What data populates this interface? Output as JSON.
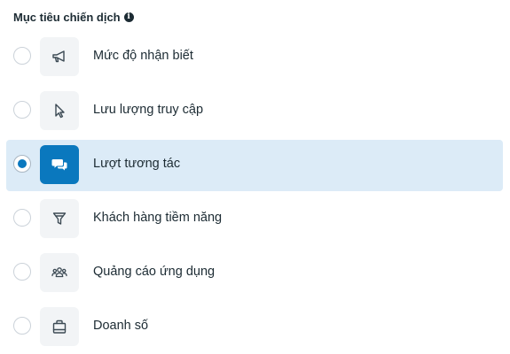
{
  "header": {
    "title": "Mục tiêu chiến dịch",
    "info_glyph": "i"
  },
  "options": [
    {
      "label": "Mức độ nhận biết",
      "icon": "megaphone-icon",
      "selected": false
    },
    {
      "label": "Lưu lượng truy cập",
      "icon": "cursor-icon",
      "selected": false
    },
    {
      "label": "Lượt tương tác",
      "icon": "chat-bubbles-icon",
      "selected": true
    },
    {
      "label": "Khách hàng tiềm năng",
      "icon": "filter-icon",
      "selected": false
    },
    {
      "label": "Quảng cáo ứng dụng",
      "icon": "people-icon",
      "selected": false
    },
    {
      "label": "Doanh số",
      "icon": "shopping-bag-icon",
      "selected": false
    }
  ],
  "colors": {
    "accent": "#0a78be",
    "selected_row_bg": "#dcebf7",
    "tile_bg": "#f2f4f6",
    "text": "#1c2b33"
  }
}
